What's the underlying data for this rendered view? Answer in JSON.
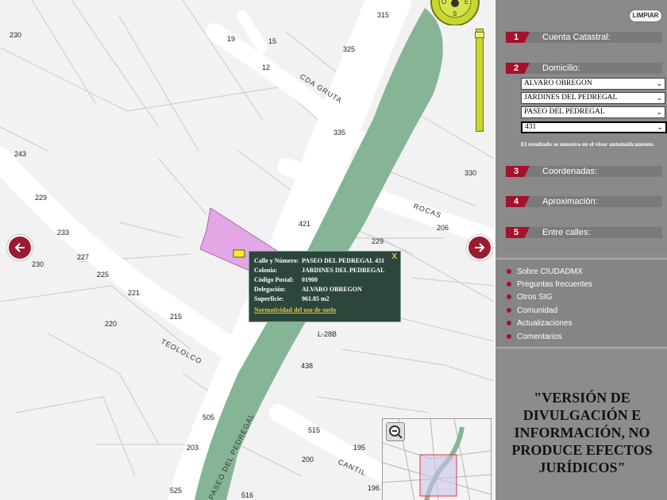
{
  "map": {
    "numbers": [
      "315",
      "230",
      "19",
      "15",
      "325",
      "12",
      "335",
      "243",
      "330",
      "229",
      "421",
      "206",
      "233",
      "229",
      "227",
      "230",
      "225",
      "221",
      "215",
      "220",
      "L-28B",
      "438",
      "505",
      "515",
      "203",
      "195",
      "200",
      "196",
      "525",
      "516"
    ],
    "streets": [
      "CDA GRUTA",
      "ROCAS",
      "TEOLOLCO",
      "CANTIL",
      "PASEO DEL PEDREGAL"
    ],
    "compass": {
      "w": "O",
      "e": "E",
      "s": "S"
    },
    "popup": {
      "rows": [
        {
          "label": "Calle y Número:",
          "value": "PASEO DEL PEDREGAL 431"
        },
        {
          "label": "Colonia:",
          "value": "JARDINES DEL PEDREGAL"
        },
        {
          "label": "Código Postal:",
          "value": "01900"
        },
        {
          "label": "Delegación:",
          "value": "ALVARO OBREGON"
        },
        {
          "label": "Superficie:",
          "value": "961.85 m2"
        }
      ],
      "link": "Normatividad del uso de suelo",
      "close": "X"
    },
    "colors": {
      "park": "#86b596",
      "parcel": "#e3a7e6",
      "marker": "#f4ef1f"
    }
  },
  "panel": {
    "clear_label": "LIMPIAR",
    "steps": [
      {
        "num": "1",
        "label": "Cuenta Catastral:"
      },
      {
        "num": "2",
        "label": "Domicilio:"
      },
      {
        "num": "3",
        "label": "Coordenadas:"
      },
      {
        "num": "4",
        "label": "Aproximación:"
      },
      {
        "num": "5",
        "label": "Entre calles:"
      }
    ],
    "address": {
      "delegacion": "ALVARO OBREGON",
      "colonia": "JARDINES DEL PEDREGAL",
      "calle": "PASEO DEL PEDREGAL",
      "numero": "431"
    },
    "hint": "El resultado se muestra en el visor automáticamente.",
    "links": [
      "Sobre CIUDADMX",
      "Preguntas frecuentes",
      "Otros SIG",
      "Comunidad",
      "Actualizaciones",
      "Comentarios"
    ],
    "disclaimer": "\"VERSIÓN DE DIVULGACIÓN E INFORMACIÓN, NO PRODUCE EFECTOS JURÍDICOS\"",
    "accent": "#a3112b"
  }
}
